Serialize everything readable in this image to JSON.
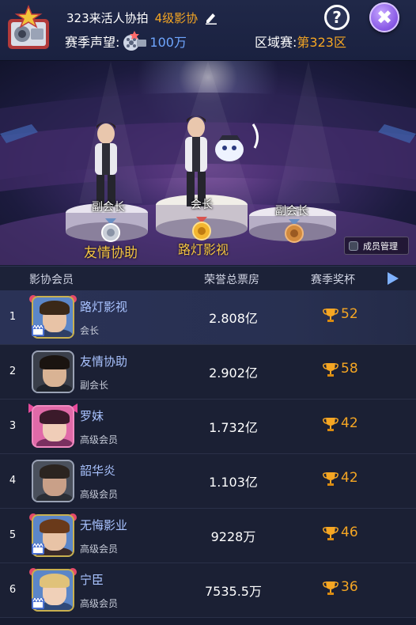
{
  "header": {
    "club_name": "323来活人协拍",
    "level": "4级影协",
    "season_label": "赛季声望:",
    "season_value": "100万",
    "region_label": "区域赛:",
    "region_value": "第323区",
    "help_label": "?",
    "close_label": "✖"
  },
  "stage": {
    "podiums": [
      {
        "title": "副会长",
        "name": "友情协助",
        "medal": "silver"
      },
      {
        "title": "会长",
        "name": "路灯影视",
        "medal": "gold"
      },
      {
        "title": "副会长",
        "name": "",
        "medal": "bronze"
      }
    ],
    "manage_label": "成员管理"
  },
  "table": {
    "headers": {
      "member": "影协会员",
      "votes": "荣誉总票房",
      "reward": "赛季奖杯"
    },
    "rows": [
      {
        "rank": "1",
        "name": "路灯影视",
        "role": "会长",
        "votes": "2.808亿",
        "trophies": "52"
      },
      {
        "rank": "2",
        "name": "友情协助",
        "role": "副会长",
        "votes": "2.902亿",
        "trophies": "58"
      },
      {
        "rank": "3",
        "name": "罗妹",
        "role": "高级会员",
        "votes": "1.732亿",
        "trophies": "42"
      },
      {
        "rank": "4",
        "name": "韶华炎",
        "role": "高级会员",
        "votes": "1.103亿",
        "trophies": "42"
      },
      {
        "rank": "5",
        "name": "无悔影业",
        "role": "高级会员",
        "votes": "9228万",
        "trophies": "46"
      },
      {
        "rank": "6",
        "name": "宁臣",
        "role": "高级会员",
        "votes": "7535.5万",
        "trophies": "36"
      }
    ]
  },
  "colors": {
    "accent_orange": "#f5a623",
    "accent_blue": "#6fa6ff",
    "name_blue": "#a9c3ff",
    "close_purple": "#8a5be6"
  }
}
